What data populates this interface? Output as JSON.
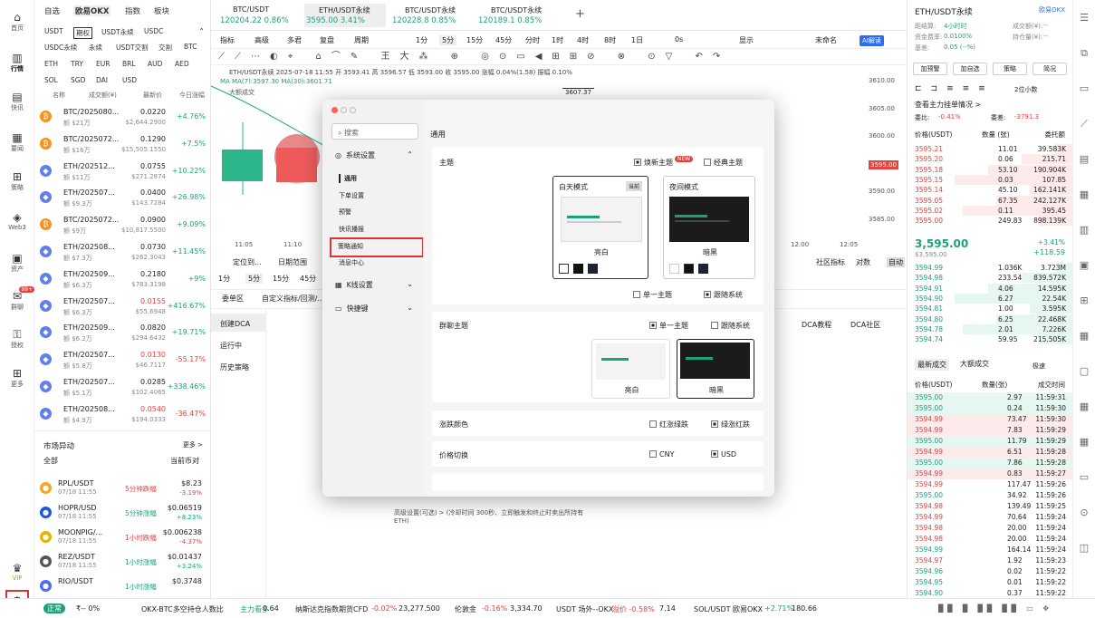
{
  "iconbar": [
    {
      "icon": "home-icon",
      "label": "首页"
    },
    {
      "icon": "market-icon",
      "label": "行情"
    },
    {
      "icon": "news-icon",
      "label": "快讯"
    },
    {
      "icon": "news2-icon",
      "label": "要闻"
    },
    {
      "icon": "strategy-icon",
      "label": "策略"
    },
    {
      "icon": "web3-icon",
      "label": "Web3"
    },
    {
      "icon": "assets-icon",
      "label": "资产"
    },
    {
      "icon": "chat-icon",
      "label": "群聊",
      "badge": "99+"
    },
    {
      "icon": "auth-icon",
      "label": "授权"
    },
    {
      "icon": "more-icon",
      "label": "更多"
    },
    {
      "icon": "vip-icon",
      "label": "VIP"
    }
  ],
  "market": {
    "tabs": [
      "自选",
      "欧易OKX",
      "指数",
      "板块"
    ],
    "sub1": [
      "USDT",
      "期权",
      "USDT永续",
      "USDC"
    ],
    "sub2": [
      "USDC永续",
      "永续",
      "USDT交割",
      "交割",
      "BTC"
    ],
    "sub3": [
      "ETH",
      "TRY",
      "EUR",
      "BRL",
      "AUD",
      "AED"
    ],
    "sub4": [
      "SOL",
      "SGD",
      "DAI",
      "USD"
    ],
    "headers": [
      "名称",
      "成交额(¥)",
      "最新价",
      "今日涨幅"
    ],
    "rows": [
      {
        "coin": "BTC",
        "name": "BTC/2025080...",
        "vol": "额 $21万",
        "price": "0.0220",
        "sub": "$2,644.2900",
        "chg": "+4.76%",
        "up": true
      },
      {
        "coin": "BTC",
        "name": "BTC/2025072...",
        "vol": "额 $16万",
        "price": "0.1290",
        "sub": "$15,505.1550",
        "chg": "+7.5%",
        "up": true
      },
      {
        "coin": "ETH",
        "name": "ETH/202512...",
        "vol": "额 $11万",
        "price": "0.0755",
        "sub": "$271.2874",
        "chg": "+10.22%",
        "up": true
      },
      {
        "coin": "ETH",
        "name": "ETH/202507...",
        "vol": "额 $9.3万",
        "price": "0.0400",
        "sub": "$143.7284",
        "chg": "+26.98%",
        "up": true
      },
      {
        "coin": "BTC",
        "name": "BTC/2025072...",
        "vol": "额 $9万",
        "price": "0.0900",
        "sub": "$10,817.5500",
        "chg": "+9.09%",
        "up": true
      },
      {
        "coin": "ETH",
        "name": "ETH/202508...",
        "vol": "额 $7.3万",
        "price": "0.0730",
        "sub": "$262.3043",
        "chg": "+11.45%",
        "up": true
      },
      {
        "coin": "ETH",
        "name": "ETH/202509...",
        "vol": "额 $6.3万",
        "price": "0.2180",
        "sub": "$783.3198",
        "chg": "+9%",
        "up": true
      },
      {
        "coin": "ETH",
        "name": "ETH/202507...",
        "vol": "额 $6.3万",
        "price": "0.0155",
        "sub": "$55.6948",
        "chg": "+416.67%",
        "up": false
      },
      {
        "coin": "ETH",
        "name": "ETH/202509...",
        "vol": "额 $6.2万",
        "price": "0.0820",
        "sub": "$294.6432",
        "chg": "+19.71%",
        "up": true
      },
      {
        "coin": "ETH",
        "name": "ETH/202507...",
        "vol": "额 $5.8万",
        "price": "0.0130",
        "sub": "$46.7117",
        "chg": "-55.17%",
        "up": false
      },
      {
        "coin": "ETH",
        "name": "ETH/202507...",
        "vol": "额 $5.1万",
        "price": "0.0285",
        "sub": "$102.4065",
        "chg": "+338.46%",
        "up": true
      },
      {
        "coin": "ETH",
        "name": "ETH/202508...",
        "vol": "额 $4.9万",
        "price": "0.0540",
        "sub": "$194.0333",
        "chg": "-36.47%",
        "up": false
      }
    ],
    "movers_title": "市场异动",
    "more": "更多 >",
    "all": "全部",
    "current_only": "当前币对",
    "movers": [
      {
        "name": "RPL/USDT",
        "time": "07/18 11:55",
        "tag": "5分钟跌幅",
        "price": "$8.23",
        "chg": "-3.19%",
        "up": false
      },
      {
        "name": "HOPR/USD",
        "time": "07/18 11:55",
        "tag": "5分钟涨幅",
        "price": "$0.06519",
        "chg": "+8.23%",
        "up": true
      },
      {
        "name": "MOONPIG/...",
        "time": "07/18 11:55",
        "tag": "1小时跌幅",
        "price": "$0.006238",
        "chg": "-4.37%",
        "up": false
      },
      {
        "name": "REZ/USDT",
        "time": "07/18 11:55",
        "tag": "1小时涨幅",
        "price": "$0.01437",
        "chg": "+3.24%",
        "up": true
      },
      {
        "name": "RIO/USDT",
        "time": "",
        "tag": "1小时涨幅",
        "price": "$0.3748",
        "chg": "",
        "up": true
      }
    ]
  },
  "toptabs": [
    {
      "name": "BTC/USDT",
      "price": "120204.22",
      "chg": "0.86%"
    },
    {
      "name": "ETH/USDT永续",
      "price": "3595.00",
      "chg": "3.41%"
    },
    {
      "name": "BTC/USDT永续",
      "price": "120228.8",
      "chg": "0.85%"
    },
    {
      "name": "BTC/USDT永续",
      "price": "120189.1",
      "chg": "0.85%"
    }
  ],
  "toolbar": [
    "指标",
    "高级",
    "多君",
    "复盘",
    "周期",
    "1分",
    "5分",
    "15分",
    "45分",
    "分时",
    "1时",
    "4时",
    "8时",
    "1日",
    "0s",
    "显示",
    "未命名",
    "AI解读"
  ],
  "chartinfo": {
    "line1": "ETH/USDT永续 2025-07-18 11:55 开 3593.41 高 3596.57 低 3593.00 收 3595.00 涨幅 0.04%(1.58) 振幅 0.10%",
    "ma": "MA MA(7):3597.30 MA(30):3601.71",
    "tag": "大额成交",
    "peak": "3607.37"
  },
  "yaxis": [
    "3610.00",
    "3605.00",
    "3600.00",
    "3595.00",
    "3590.00",
    "3585.00"
  ],
  "xaxis": [
    "11:05",
    "11:10",
    "12:00",
    "12:05"
  ],
  "bottom": {
    "tabs": [
      "1分",
      "5分",
      "15分",
      "45分"
    ],
    "locate": "定位到...",
    "range": "日期范围",
    "tab2": "委单区",
    "tab3": "自定义指标/回测/...",
    "dca": [
      "创建DCA",
      "运行中",
      "历史策略"
    ],
    "dcalinks": [
      "DCA教程",
      "DCA社区"
    ],
    "rightlinks": [
      "社区指标",
      "对数",
      "自动"
    ],
    "note": "高级设置(可选) > (冷却时间 300秒、立即触发和终止时卖出所持有ETH)"
  },
  "modal": {
    "search": "搜索",
    "sections": [
      {
        "label": "系统设置",
        "items": [
          "通用",
          "下单设置",
          "预警",
          "快讯播报",
          "策略通知",
          "消息中心"
        ]
      },
      {
        "label": "K线设置",
        "items": []
      },
      {
        "label": "快捷键",
        "items": []
      }
    ],
    "title": "通用",
    "theme": {
      "label": "主题",
      "new_theme": "焕新主题",
      "new_badge": "NEW",
      "classic": "经典主题",
      "day": "白天模式",
      "current": "当前",
      "night": "夜间模式",
      "light": "亮白",
      "dark": "暗黑",
      "single": "单一主题",
      "follow": "跟随系统"
    },
    "chat": {
      "label": "群聊主题",
      "single": "单一主题",
      "follow": "跟随系统",
      "light": "亮白",
      "dark": "暗黑"
    },
    "color": {
      "label": "涨跌颜色",
      "opt1": "红涨绿跌",
      "opt2": "绿涨红跌"
    },
    "price": {
      "label": "价格切换",
      "opt1": "CNY",
      "opt2": "USD"
    }
  },
  "rightpanel": {
    "pair": "ETH/USDT永续",
    "exchange": "欧易OKX",
    "info": [
      [
        "距结算:",
        "4小时时",
        "成交额(¥):",
        "--"
      ],
      [
        "资金费率:",
        "0.0100%",
        "持仓量(¥):",
        "--"
      ],
      [
        "基差:",
        "0.05 (--%)",
        "",
        ""
      ]
    ],
    "buttons": [
      "加预警",
      "加自选",
      "策略",
      "简况"
    ],
    "depth": "2位小数",
    "whale": "查看主力挂单情况 >",
    "buyratio": "委比:",
    "buyratio_v": "-0.41%",
    "buydiff": "委差:",
    "buydiff_v": "-3791.3",
    "ob_headers": [
      "价格(USDT)",
      "数量 (张)",
      "委托额"
    ],
    "asks": [
      [
        "3595.21",
        "11.01",
        "39.583K"
      ],
      [
        "3595.20",
        "0.06",
        "215.71"
      ],
      [
        "3595.18",
        "53.10",
        "190.904K"
      ],
      [
        "3595.15",
        "0.03",
        "107.85"
      ],
      [
        "3595.14",
        "45.10",
        "162.141K"
      ],
      [
        "3595.05",
        "67.35",
        "242.127K"
      ],
      [
        "3595.02",
        "0.11",
        "395.45"
      ],
      [
        "3595.00",
        "249.83",
        "898.139K"
      ]
    ],
    "last": "3,595.00",
    "last_sub": "$3,595.00",
    "last_pct": "+3.41%",
    "last_chg": "+118.59",
    "bids": [
      [
        "3594.99",
        "1.036K",
        "3.723M"
      ],
      [
        "3594.98",
        "233.54",
        "839.572K"
      ],
      [
        "3594.91",
        "4.06",
        "14.595K"
      ],
      [
        "3594.90",
        "6.27",
        "22.54K"
      ],
      [
        "3594.81",
        "1.00",
        "3.595K"
      ],
      [
        "3594.80",
        "6.25",
        "22.468K"
      ],
      [
        "3594.78",
        "2.01",
        "7.226K"
      ],
      [
        "3594.74",
        "59.95",
        "215.505K"
      ]
    ],
    "trades_tabs": [
      "最新成交",
      "大额成交"
    ],
    "trades_opt": "极速",
    "trades_headers": [
      "价格(USDT)",
      "数量(张)",
      "成交时间"
    ],
    "trades": [
      [
        "3595.00",
        "2.97",
        "11:59:31",
        "g"
      ],
      [
        "3595.00",
        "0.24",
        "11:59:30",
        "g"
      ],
      [
        "3594.99",
        "73.47",
        "11:59:30",
        "r"
      ],
      [
        "3594.99",
        "7.83",
        "11:59:29",
        "r"
      ],
      [
        "3595.00",
        "11.79",
        "11:59:29",
        "g"
      ],
      [
        "3594.99",
        "6.51",
        "11:59:28",
        "r"
      ],
      [
        "3595.00",
        "7.86",
        "11:59:28",
        "g"
      ],
      [
        "3594.99",
        "0.83",
        "11:59:27",
        "r"
      ],
      [
        "3594.99",
        "117.47",
        "11:59:26",
        "r"
      ],
      [
        "3595.00",
        "34.92",
        "11:59:26",
        "g"
      ],
      [
        "3594.98",
        "139.49",
        "11:59:25",
        "r"
      ],
      [
        "3594.99",
        "70.64",
        "11:59:24",
        "r"
      ],
      [
        "3594.98",
        "20.00",
        "11:59:24",
        "r"
      ],
      [
        "3594.98",
        "20.00",
        "11:59:24",
        "r"
      ],
      [
        "3594.99",
        "164.14",
        "11:59:24",
        "g"
      ],
      [
        "3594.97",
        "1.92",
        "11:59:23",
        "r"
      ],
      [
        "3594.96",
        "0.02",
        "11:59:22",
        "g"
      ],
      [
        "3594.95",
        "0.01",
        "11:59:22",
        "g"
      ],
      [
        "3594.90",
        "0.37",
        "11:59:22",
        "g"
      ]
    ]
  },
  "footer": {
    "status": "正常",
    "wifi": "₹-- 0%",
    "items": [
      [
        "OKX-BTC多空持仓人数比",
        "主力看多",
        "0.64"
      ],
      [
        "纳斯达克指数期货CFD",
        "-0.02%",
        "23,277.500"
      ],
      [
        "伦敦金",
        "-0.16%",
        "3,334.70"
      ],
      [
        "USDT 场外--OKX",
        "溢价 -0.58%",
        "7.14"
      ],
      [
        "SOL/USDT 欧易OKX",
        "+2.71%",
        "180.66"
      ]
    ]
  }
}
